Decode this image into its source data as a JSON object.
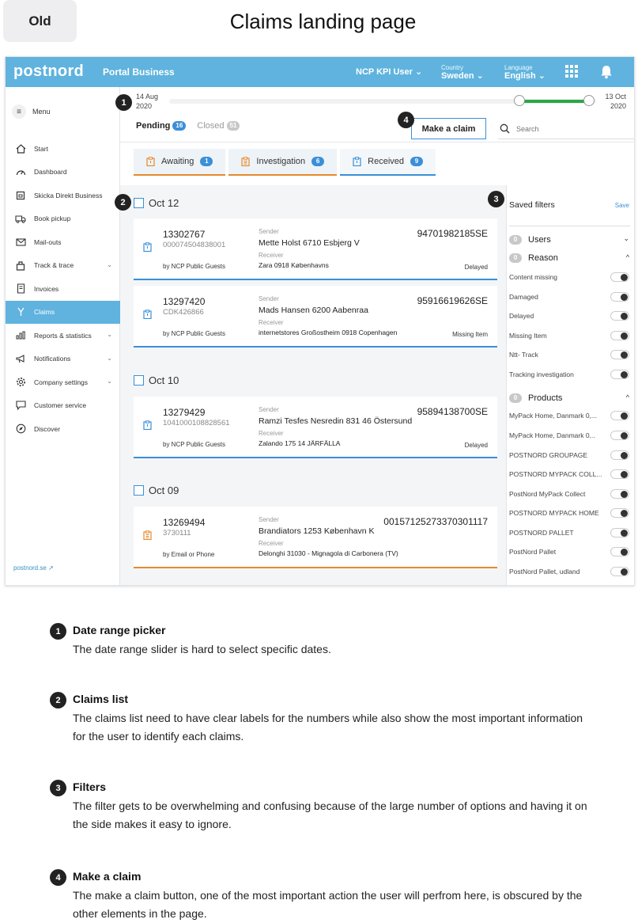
{
  "header": {
    "badge": "Old",
    "title": "Claims landing page"
  },
  "topbar": {
    "logo": "postnord",
    "portal": "Portal Business",
    "user": "NCP KPI User",
    "country_label": "Country",
    "country_value": "Sweden",
    "language_label": "Language",
    "language_value": "English",
    "chevron": "⌄",
    "icons": [
      "apps-grid-icon",
      "bell-icon"
    ],
    "color": "#5fb3de"
  },
  "sidebar": {
    "menu_label": "Menu",
    "items": [
      {
        "label": "Start",
        "icon": "home-icon"
      },
      {
        "label": "Dashboard",
        "icon": "speedometer-icon"
      },
      {
        "label": "Skicka Direkt Business",
        "icon": "package-icon"
      },
      {
        "label": "Book pickup",
        "icon": "truck-icon"
      },
      {
        "label": "Mail-outs",
        "icon": "mail-icon"
      },
      {
        "label": "Track & trace",
        "icon": "parcel-icon",
        "chevron": "⌄"
      },
      {
        "label": "Invoices",
        "icon": "invoice-icon"
      },
      {
        "label": "Claims",
        "icon": "claims-icon",
        "active": true
      },
      {
        "label": "Reports & statistics",
        "icon": "bar-chart-icon",
        "chevron": "⌄"
      },
      {
        "label": "Notifications",
        "icon": "megaphone-icon",
        "chevron": "⌄"
      },
      {
        "label": "Company settings",
        "icon": "gear-icon",
        "chevron": "⌄"
      },
      {
        "label": "Customer service",
        "icon": "chat-icon"
      },
      {
        "label": "Discover",
        "icon": "compass-icon"
      }
    ],
    "footer_link": "postnord.se ↗"
  },
  "date_range": {
    "start_day": "14 Aug",
    "start_year": "2020",
    "end_day": "13 Oct",
    "end_year": "2020",
    "selected_fraction": [
      0.888,
      1.0
    ],
    "fill_color": "#2aa845"
  },
  "tabs": {
    "pending_label": "Pending",
    "pending_count": "16",
    "closed_label": "Closed",
    "closed_count": "51"
  },
  "make_claim_label": "Make a claim",
  "search_placeholder": "Search",
  "subtabs": [
    {
      "label": "Awaiting",
      "count": "1",
      "accent": "#e48a2c"
    },
    {
      "label": "Investigation",
      "count": "6",
      "accent": "#e48a2c"
    },
    {
      "label": "Received",
      "count": "9",
      "accent": "#3a8fd8"
    }
  ],
  "labels": {
    "sender": "Sender",
    "receiver": "Receiver"
  },
  "groups": [
    {
      "date": "Oct 12",
      "claims": [
        {
          "id": "13302767",
          "ref": "000074504838001",
          "by": "by NCP Public Guests",
          "sender": "Mette Holst 6710 Esbjerg V",
          "receiver": "Zara 0918 Københavns",
          "tracking": "94701982185SE",
          "status": "Delayed",
          "accent": "blue"
        },
        {
          "id": "13297420",
          "ref": "CDK426866",
          "by": "by NCP Public Guests",
          "sender": "Mads Hansen 6200 Aabenraa",
          "receiver": "internetstores Großostheim 0918 Copenhagen",
          "tracking": "95916619626SE",
          "status": "Missing Item",
          "accent": "blue"
        }
      ]
    },
    {
      "date": "Oct 10",
      "claims": [
        {
          "id": "13279429",
          "ref": "1041000108828561",
          "by": "by NCP Public Guests",
          "sender": "Ramzi Tesfes Nesredin 831 46 Östersund",
          "receiver": "Zalando 175 14 JÄRFÄLLA",
          "tracking": "95894138700SE",
          "status": "Delayed",
          "accent": "blue"
        }
      ]
    },
    {
      "date": "Oct 09",
      "claims": [
        {
          "id": "13269494",
          "ref": "3730111",
          "by": "by Email or Phone",
          "sender": "Brandiators 1253 København K",
          "receiver": "Delonghi 31030 - Mignagola di Carbonera (TV)",
          "tracking": "00157125273370301117",
          "status": "",
          "accent": "orange"
        }
      ]
    }
  ],
  "filters": {
    "title": "Saved filters",
    "save": "Save",
    "users": {
      "count": "0",
      "label": "Users",
      "arrow": "⌄"
    },
    "reason": {
      "count": "0",
      "label": "Reason",
      "arrow": "^"
    },
    "reason_items": [
      "Content missing",
      "Damaged",
      "Delayed",
      "Missing Item",
      "Ntt- Track",
      "Tracking investigation"
    ],
    "products": {
      "count": "0",
      "label": "Products",
      "arrow": "^"
    },
    "product_items": [
      "MyPack Home, Danmark 0,...",
      "MyPack Home, Danmark 0...",
      "POSTNORD GROUPAGE",
      "POSTNORD MYPACK COLL...",
      "PostNord MyPack Collect",
      "POSTNORD MYPACK HOME",
      "POSTNORD PALLET",
      "PostNord Pallet",
      "PostNord Pallet, udland"
    ]
  },
  "markers": [
    "1",
    "2",
    "3",
    "4"
  ],
  "notes": [
    {
      "num": "1",
      "title": "Date range picker",
      "text": "The date range slider is hard to select specific dates."
    },
    {
      "num": "2",
      "title": "Claims list",
      "text": "The claims list need to have clear labels for the numbers while also show the most important information for the user to identify each claims."
    },
    {
      "num": "3",
      "title": "Filters",
      "text": "The filter gets to be overwhelming and confusing because of the large number of options and having it on the side makes it easy to ignore."
    },
    {
      "num": "4",
      "title": "Make a claim",
      "text": "The make a claim button, one of the most important action the user will perfrom here, is obscured by the other elements in the page."
    }
  ]
}
